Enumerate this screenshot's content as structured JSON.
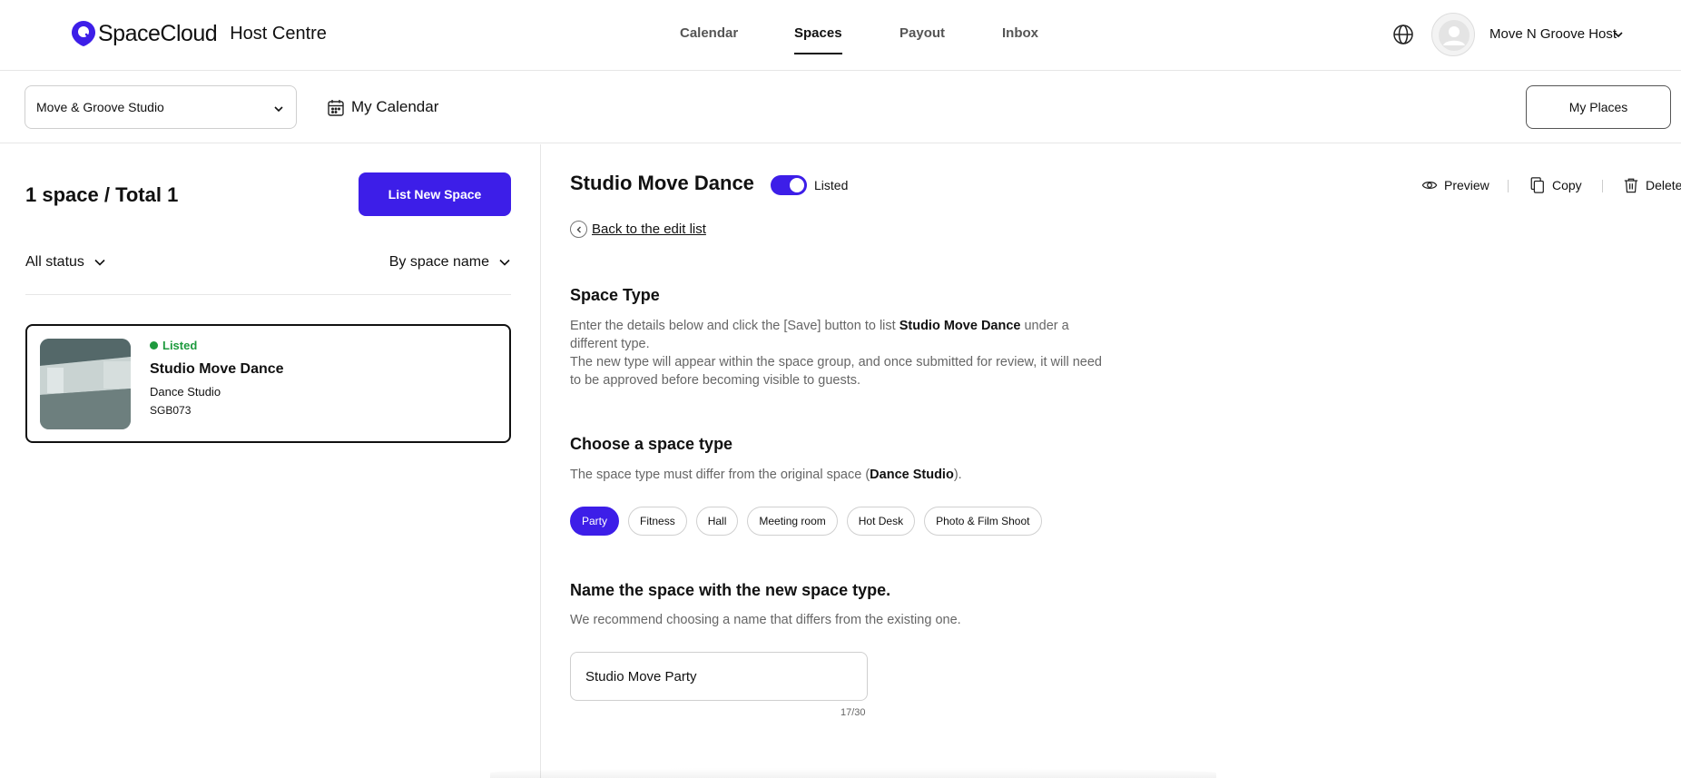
{
  "brand": {
    "name": "SpaceCloud",
    "section": "Host Centre",
    "accent": "#3d1ee8"
  },
  "nav": {
    "items": [
      {
        "label": "Calendar",
        "active": false
      },
      {
        "label": "Spaces",
        "active": true
      },
      {
        "label": "Payout",
        "active": false
      },
      {
        "label": "Inbox",
        "active": false
      }
    ]
  },
  "user": {
    "name": "Move N Groove Host"
  },
  "subbar": {
    "place_select": "Move & Groove Studio",
    "my_calendar": "My Calendar",
    "my_places": "My Places"
  },
  "list": {
    "count_label": "1 space / Total 1",
    "new_button": "List New Space",
    "status_filter": "All status",
    "sort_filter": "By space name",
    "items": [
      {
        "status": "Listed",
        "title": "Studio Move Dance",
        "type": "Dance Studio",
        "code": "SGB073",
        "status_color": "#1e9a3e"
      }
    ]
  },
  "detail": {
    "title": "Studio Move Dance",
    "listed_label": "Listed",
    "listed_on": true,
    "actions": {
      "preview": "Preview",
      "copy": "Copy",
      "delete": "Delete"
    },
    "back_link": "Back to the edit list",
    "space_type": {
      "heading": "Space Type",
      "p1_a": "Enter the details below and click the [Save] button to list ",
      "p1_b": "Studio Move Dance",
      "p1_c": " under a different type.",
      "p2": "The new type will appear within the space group, and once submitted for review, it will need to be approved before becoming visible to guests."
    },
    "choose": {
      "heading": "Choose a space type",
      "desc_a": "The space type must differ from the original space (",
      "desc_b": "Dance Studio",
      "desc_c": ").",
      "options": [
        "Party",
        "Fitness",
        "Hall",
        "Meeting room",
        "Hot Desk",
        "Photo & Film Shoot"
      ],
      "selected": "Party"
    },
    "name_section": {
      "heading": "Name the space with the new space type.",
      "desc": "We recommend choosing a name that differs from the existing one.",
      "value": "Studio Move Party",
      "counter": "17/30"
    }
  }
}
